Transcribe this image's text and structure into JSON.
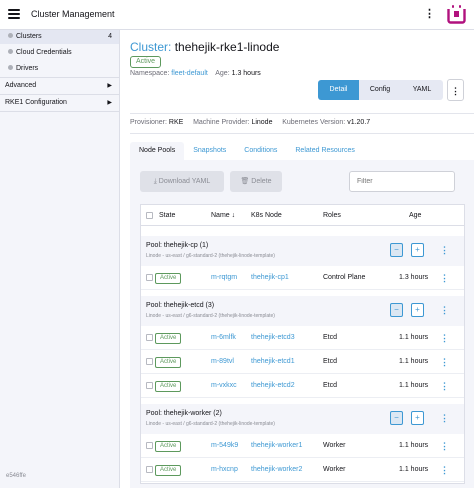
{
  "header": {
    "title": "Cluster Management"
  },
  "sidebar": {
    "clusters_label": "Clusters",
    "clusters_count": "4",
    "cloud_credentials_label": "Cloud Credentials",
    "drivers_label": "Drivers",
    "advanced_label": "Advanced",
    "rke1_label": "RKE1 Configuration",
    "version": "e546ffe"
  },
  "page": {
    "type_label": "Cluster:",
    "name": "thehejik-rke1-linode",
    "status": "Active",
    "namespace_label": "Namespace:",
    "namespace": "fleet-default",
    "age_label": "Age:",
    "age": "1.3 hours",
    "provisioner_label": "Provisioner:",
    "provisioner": "RKE",
    "machine_provider_label": "Machine Provider:",
    "machine_provider": "Linode",
    "k8s_version_label": "Kubernetes Version:",
    "k8s_version": "v1.20.7",
    "mode_buttons": [
      "Detail",
      "Config",
      "YAML"
    ],
    "active_mode": "Detail"
  },
  "tabs": [
    "Node Pools",
    "Snapshots",
    "Conditions",
    "Related Resources"
  ],
  "toolbar": {
    "download": "Download YAML",
    "delete": "Delete",
    "filter_placeholder": "Filter"
  },
  "table": {
    "columns": [
      "State",
      "Name",
      "K8s Node",
      "Roles",
      "Age"
    ],
    "pools": [
      {
        "title": "Pool: thehejik-cp (1)",
        "subtitle": "Linode - us-east / g6-standard-2 (thehejik-linode-template)",
        "nodes": [
          {
            "state": "Active",
            "name": "m-rqtgm",
            "k8s_node": "thehejik-cp1",
            "roles": "Control Plane",
            "age": "1.3 hours"
          }
        ]
      },
      {
        "title": "Pool: thehejik-etcd (3)",
        "subtitle": "Linode - us-east / g6-standard-2 (thehejik-linode-template)",
        "nodes": [
          {
            "state": "Active",
            "name": "m-6mlfk",
            "k8s_node": "thehejik-etcd3",
            "roles": "Etcd",
            "age": "1.1 hours"
          },
          {
            "state": "Active",
            "name": "m-89tvl",
            "k8s_node": "thehejik-etcd1",
            "roles": "Etcd",
            "age": "1.1 hours"
          },
          {
            "state": "Active",
            "name": "m-vxkxc",
            "k8s_node": "thehejik-etcd2",
            "roles": "Etcd",
            "age": "1.1 hours"
          }
        ]
      },
      {
        "title": "Pool: thehejik-worker (2)",
        "subtitle": "Linode - us-east / g6-standard-2 (thehejik-linode-template)",
        "nodes": [
          {
            "state": "Active",
            "name": "m-549k9",
            "k8s_node": "thehejik-worker1",
            "roles": "Worker",
            "age": "1.1 hours"
          },
          {
            "state": "Active",
            "name": "m-hxcnp",
            "k8s_node": "thehejik-worker2",
            "roles": "Worker",
            "age": "1.1 hours"
          }
        ]
      }
    ]
  },
  "colors": {
    "accent": "#3d98d3",
    "active_green": "#5d995d",
    "logo": "#b1117e"
  }
}
